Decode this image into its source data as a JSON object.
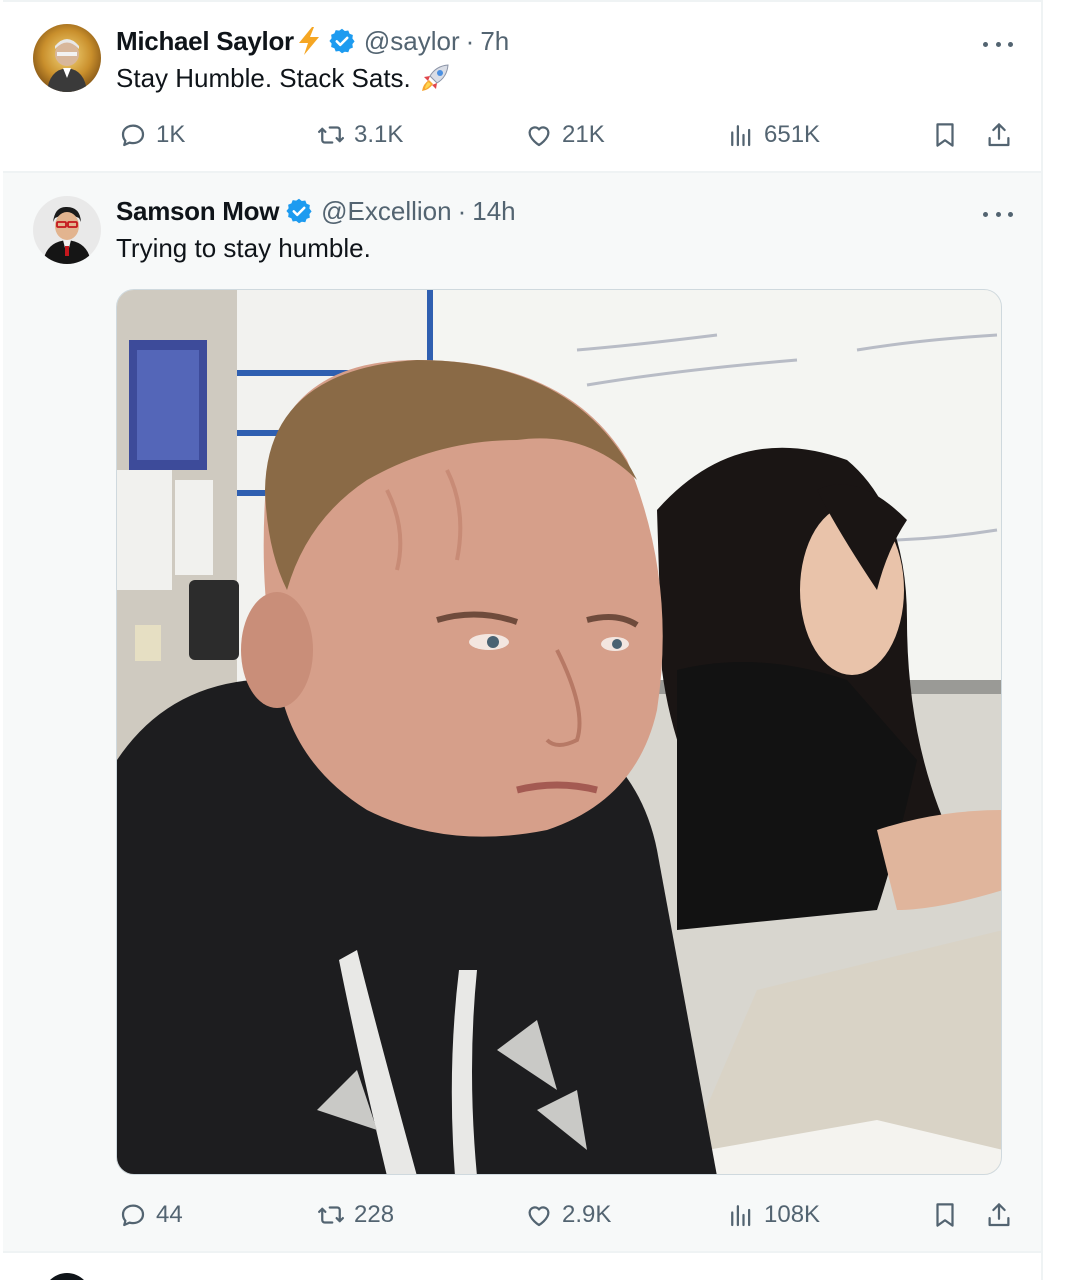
{
  "colors": {
    "text_primary": "#0f1419",
    "text_secondary": "#536471",
    "verified_blue": "#1d9bf0",
    "bolt_orange": "#f5a623",
    "quoted_bg": "#f7f9f9",
    "divider": "#eff3f4"
  },
  "tweets": [
    {
      "author_name": "Michael Saylor",
      "name_emoji": "lightning-bolt-icon",
      "verified": true,
      "handle": "@saylor",
      "separator": "·",
      "time": "7h",
      "text": "Stay Humble. Stack Sats.",
      "text_emoji": "rocket-icon",
      "stats": {
        "replies": "1K",
        "reposts": "3.1K",
        "likes": "21K",
        "views": "651K"
      }
    },
    {
      "author_name": "Samson Mow",
      "verified": true,
      "handle": "@Excellion",
      "separator": "·",
      "time": "14h",
      "text": "Trying to stay humble.",
      "media": "meme-photo",
      "stats": {
        "replies": "44",
        "reposts": "228",
        "likes": "2.9K",
        "views": "108K"
      }
    }
  ]
}
